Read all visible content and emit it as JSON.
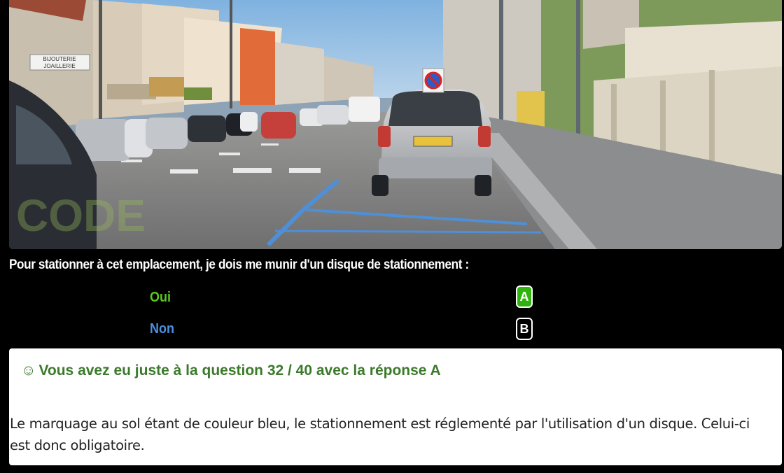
{
  "photo": {
    "sign_left_line1": "BIJOUTERIE",
    "sign_left_line2": "JOAILLERIE",
    "watermark_text": "CODE"
  },
  "quiz": {
    "question": "Pour stationner à cet emplacement, je dois me munir d'un disque de stationnement :",
    "answers": [
      {
        "label": "Oui",
        "key": "A",
        "color": "#5bc81e",
        "selected": true
      },
      {
        "label": "Non",
        "key": "B",
        "color": "#4d8fe0",
        "selected": false
      }
    ]
  },
  "result": {
    "icon": "smiley-icon",
    "icon_glyph": "☺",
    "title": "Vous avez eu juste à la question 32 / 40 avec la réponse A",
    "explanation": "Le marquage au sol étant de couleur bleu, le stationnement est réglementé par l'utilisation d'un disque. Celui-ci est donc obligatoire.",
    "title_color": "#3a7a2a"
  }
}
